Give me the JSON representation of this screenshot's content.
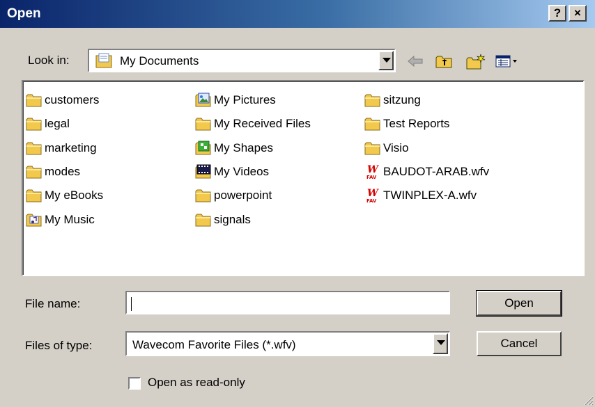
{
  "window": {
    "title": "Open",
    "help_label": "?",
    "close_label": "×"
  },
  "lookin": {
    "label": "Look in:",
    "value": "My Documents",
    "toolbar": [
      "back-arrow-icon",
      "up-one-level-icon",
      "create-new-folder-icon",
      "view-menu-icon"
    ]
  },
  "files": {
    "col1": [
      {
        "name": "customers",
        "icon": "folder-icon"
      },
      {
        "name": "legal",
        "icon": "folder-icon"
      },
      {
        "name": "marketing",
        "icon": "folder-icon"
      },
      {
        "name": "modes",
        "icon": "folder-icon"
      },
      {
        "name": "My eBooks",
        "icon": "folder-icon"
      },
      {
        "name": "My Music",
        "icon": "music-folder-icon"
      }
    ],
    "col2": [
      {
        "name": "My Pictures",
        "icon": "pictures-folder-icon"
      },
      {
        "name": "My Received Files",
        "icon": "folder-icon"
      },
      {
        "name": "My Shapes",
        "icon": "shapes-folder-icon"
      },
      {
        "name": "My Videos",
        "icon": "videos-folder-icon"
      },
      {
        "name": "powerpoint",
        "icon": "folder-icon"
      },
      {
        "name": "signals",
        "icon": "folder-icon"
      }
    ],
    "col3": [
      {
        "name": "sitzung",
        "icon": "folder-icon"
      },
      {
        "name": "Test Reports",
        "icon": "folder-icon"
      },
      {
        "name": "Visio",
        "icon": "folder-icon"
      },
      {
        "name": "BAUDOT-ARAB.wfv",
        "icon": "wfv-file-icon"
      },
      {
        "name": "TWINPLEX-A.wfv",
        "icon": "wfv-file-icon"
      }
    ]
  },
  "filename": {
    "label": "File name:",
    "value": ""
  },
  "filetype": {
    "label": "Files of type:",
    "value": "Wavecom Favorite Files (*.wfv)"
  },
  "readonly": {
    "label": "Open as read-only",
    "checked": false
  },
  "buttons": {
    "open": "Open",
    "cancel": "Cancel"
  }
}
